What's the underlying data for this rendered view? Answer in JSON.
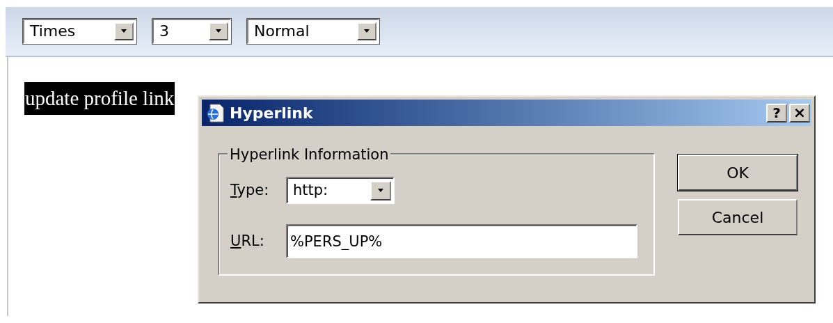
{
  "toolbar": {
    "selects": [
      {
        "value": "Times"
      },
      {
        "value": "3"
      },
      {
        "value": "Normal"
      }
    ]
  },
  "editor": {
    "selected_text": "update profile link",
    "selected": true
  },
  "dialog": {
    "title": "Hyperlink",
    "help_button": "?",
    "close_button": "×",
    "group": {
      "legend": "Hyperlink Information",
      "fields": [
        {
          "kind": "select",
          "access_key": "T",
          "label_rest": "ype:",
          "value": "http:"
        },
        {
          "kind": "text",
          "access_key": "U",
          "label_rest": "RL:",
          "value": "%PERS_UP%"
        }
      ]
    },
    "buttons": [
      {
        "label": "OK",
        "default": true
      },
      {
        "label": "Cancel",
        "default": false
      }
    ]
  }
}
